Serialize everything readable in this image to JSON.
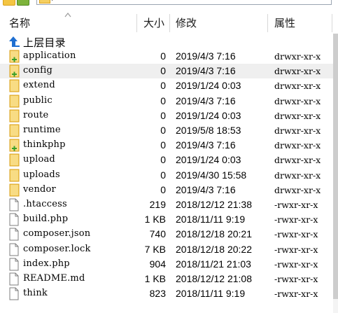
{
  "window": {
    "path_glyph": "/"
  },
  "columns": {
    "name": "名称",
    "size": "大小",
    "modified": "修改",
    "attrs": "属性"
  },
  "parent_row": {
    "label": "上层目录"
  },
  "files": [
    {
      "name": "application",
      "size": "0",
      "modified": "2019/4/3 7:16",
      "attrs": "drwxr-xr-x",
      "icon": "folder-plus-icon"
    },
    {
      "name": "config",
      "size": "0",
      "modified": "2019/4/3 7:16",
      "attrs": "drwxr-xr-x",
      "icon": "folder-plus-icon",
      "selected": true
    },
    {
      "name": "extend",
      "size": "0",
      "modified": "2019/1/24 0:03",
      "attrs": "drwxr-xr-x",
      "icon": "folder-icon"
    },
    {
      "name": "public",
      "size": "0",
      "modified": "2019/4/3 7:16",
      "attrs": "drwxr-xr-x",
      "icon": "folder-icon"
    },
    {
      "name": "route",
      "size": "0",
      "modified": "2019/1/24 0:03",
      "attrs": "drwxr-xr-x",
      "icon": "folder-icon"
    },
    {
      "name": "runtime",
      "size": "0",
      "modified": "2019/5/8 18:53",
      "attrs": "drwxr-xr-x",
      "icon": "folder-icon"
    },
    {
      "name": "thinkphp",
      "size": "0",
      "modified": "2019/4/3 7:16",
      "attrs": "drwxr-xr-x",
      "icon": "folder-plus-icon"
    },
    {
      "name": "upload",
      "size": "0",
      "modified": "2019/1/24 0:03",
      "attrs": "drwxr-xr-x",
      "icon": "folder-icon"
    },
    {
      "name": "uploads",
      "size": "0",
      "modified": "2019/4/30 15:58",
      "attrs": "drwxr-xr-x",
      "icon": "folder-icon"
    },
    {
      "name": "vendor",
      "size": "0",
      "modified": "2019/4/3 7:16",
      "attrs": "drwxr-xr-x",
      "icon": "folder-icon"
    },
    {
      "name": ".htaccess",
      "size": "219",
      "modified": "2018/12/12 21:38",
      "attrs": "-rwxr-xr-x",
      "icon": "file-icon"
    },
    {
      "name": "build.php",
      "size": "1 KB",
      "modified": "2018/11/11 9:19",
      "attrs": "-rwxr-xr-x",
      "icon": "file-icon"
    },
    {
      "name": "composer.json",
      "size": "740",
      "modified": "2018/12/18 20:21",
      "attrs": "-rwxr-xr-x",
      "icon": "file-icon"
    },
    {
      "name": "composer.lock",
      "size": "7 KB",
      "modified": "2018/12/18 20:22",
      "attrs": "-rwxr-xr-x",
      "icon": "file-icon"
    },
    {
      "name": "index.php",
      "size": "904",
      "modified": "2018/11/21 21:03",
      "attrs": "-rwxr-xr-x",
      "icon": "file-icon"
    },
    {
      "name": "README.md",
      "size": "1 KB",
      "modified": "2018/12/12 21:08",
      "attrs": "-rwxr-xr-x",
      "icon": "file-icon"
    },
    {
      "name": "think",
      "size": "823",
      "modified": "2018/11/11 9:19",
      "attrs": "-rwxr-xr-x",
      "icon": "file-icon"
    }
  ],
  "colors": {
    "folder": "#f5cf60",
    "folder_border": "#d9a11b",
    "plus": "#3aa02a",
    "up_arrow": "#1f6fd1",
    "selection": "#efefef"
  }
}
